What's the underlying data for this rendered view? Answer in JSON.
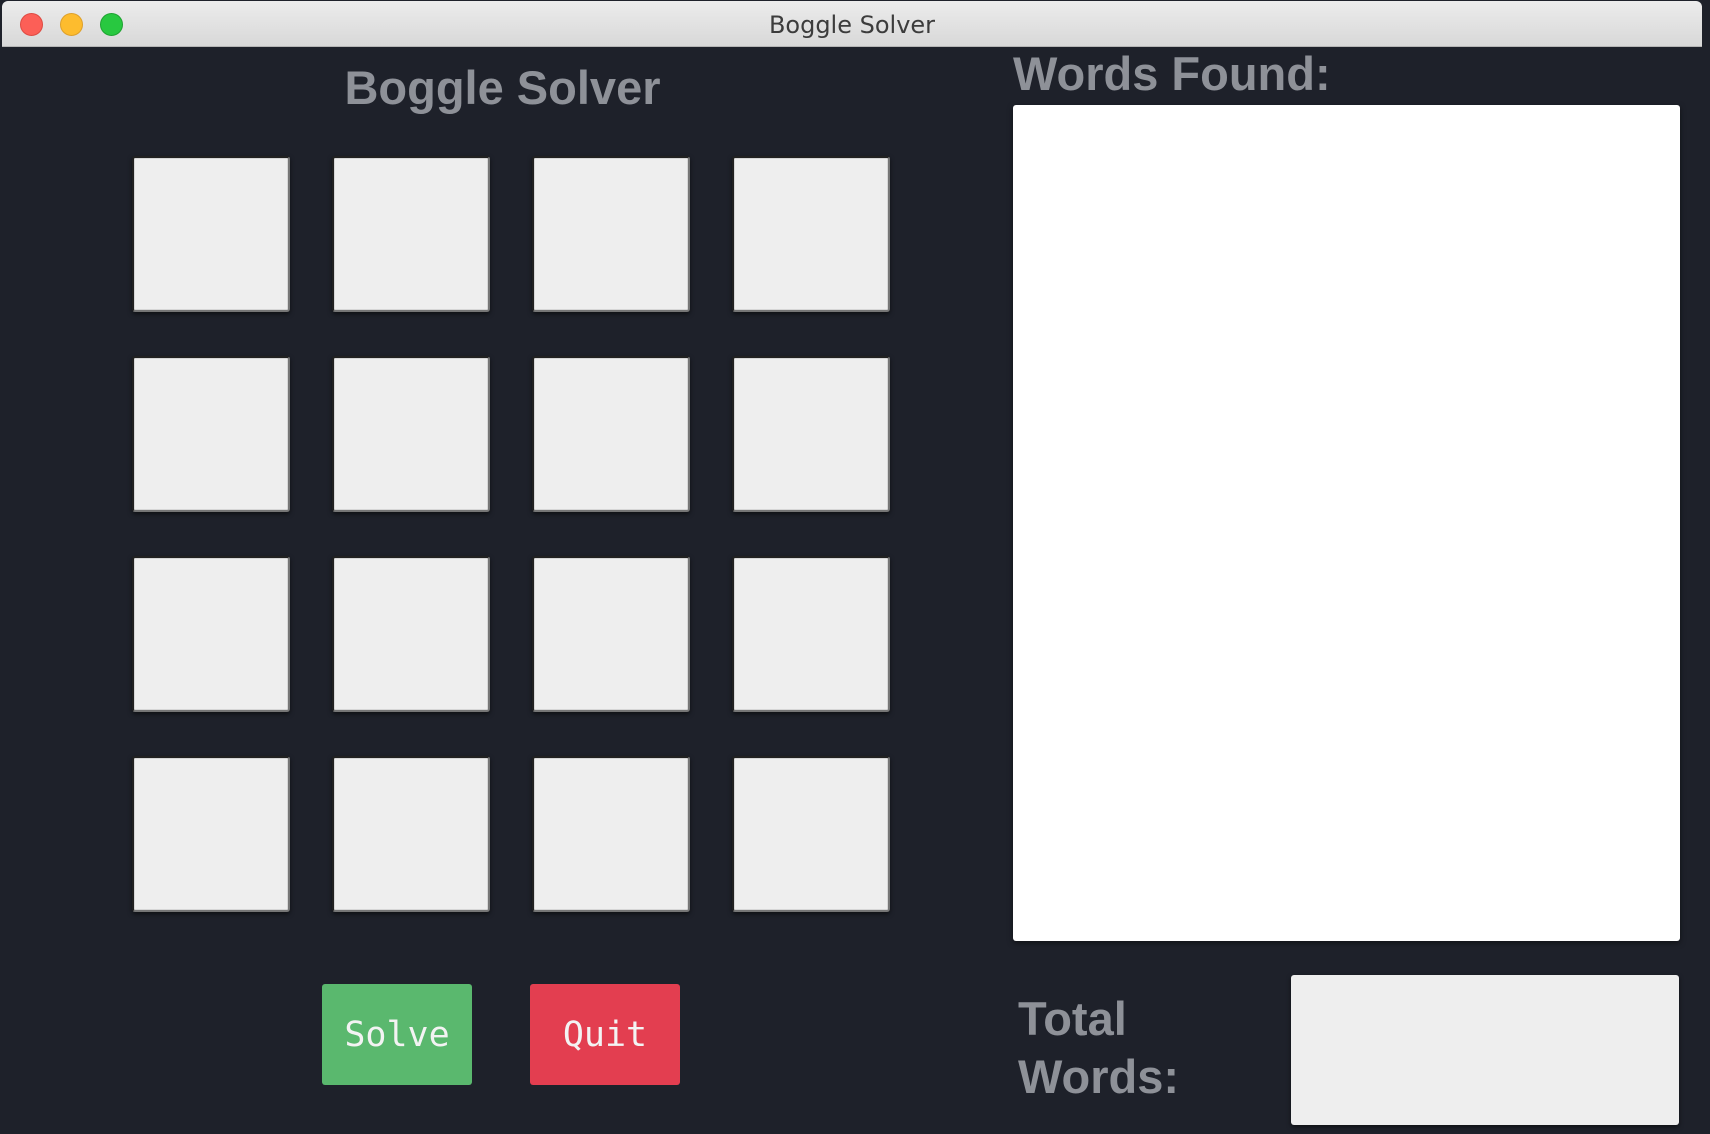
{
  "window": {
    "title": "Boggle Solver"
  },
  "app": {
    "heading": "Boggle Solver"
  },
  "board": {
    "tiles": [
      "",
      "",
      "",
      "",
      "",
      "",
      "",
      "",
      "",
      "",
      "",
      "",
      "",
      "",
      "",
      ""
    ]
  },
  "buttons": {
    "solve_label": "Solve",
    "quit_label": "Quit"
  },
  "results": {
    "words_found_label": "Words Found:",
    "words": [],
    "total_label": "Total Words:",
    "total_value": ""
  },
  "colors": {
    "background": "#1e212a",
    "label_gray": "#8e9198",
    "tile": "#eeeeee",
    "solve_green": "#5ab86e",
    "quit_red": "#e33e50"
  }
}
